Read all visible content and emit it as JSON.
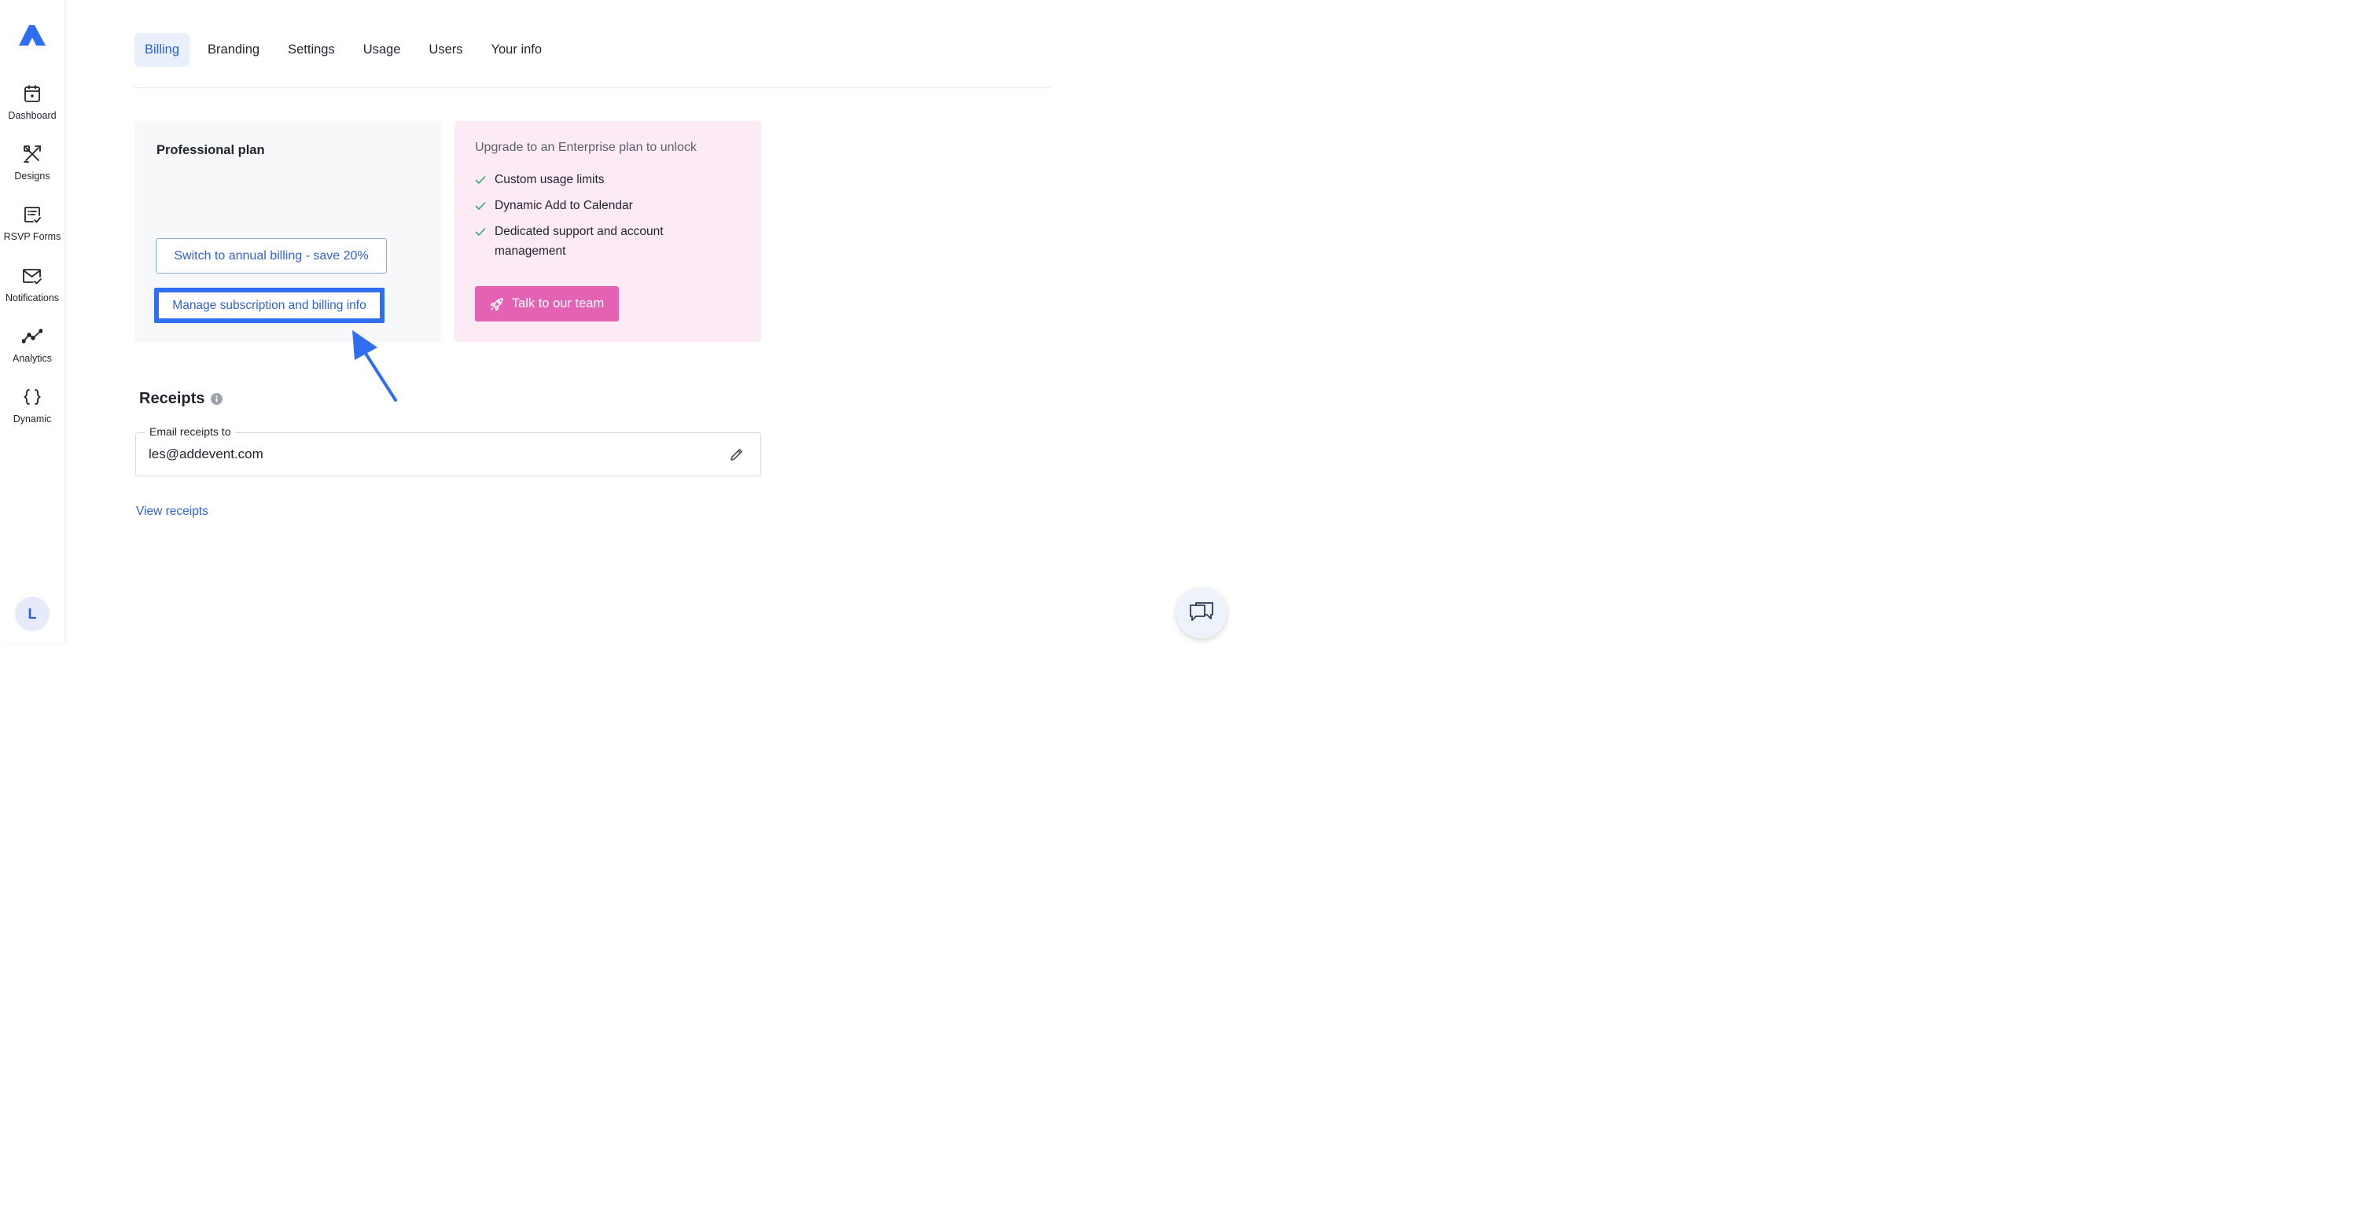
{
  "sidebar": {
    "logo_icon": "addevent-logo-icon",
    "items": [
      {
        "label": "Dashboard",
        "icon": "calendar-icon"
      },
      {
        "label": "Designs",
        "icon": "design-tools-icon"
      },
      {
        "label": "RSVP Forms",
        "icon": "rsvp-form-icon"
      },
      {
        "label": "Notifications",
        "icon": "envelope-check-icon"
      },
      {
        "label": "Analytics",
        "icon": "line-chart-icon"
      },
      {
        "label": "Dynamic",
        "icon": "curly-braces-icon"
      }
    ],
    "avatar_initial": "L"
  },
  "tabs": [
    {
      "label": "Billing",
      "active": true
    },
    {
      "label": "Branding",
      "active": false
    },
    {
      "label": "Settings",
      "active": false
    },
    {
      "label": "Usage",
      "active": false
    },
    {
      "label": "Users",
      "active": false
    },
    {
      "label": "Your info",
      "active": false
    }
  ],
  "plan": {
    "title": "Professional plan",
    "annual_button": "Switch to annual billing - save 20%",
    "manage_button": "Manage subscription and billing info"
  },
  "enterprise": {
    "heading": "Upgrade to an Enterprise plan to unlock",
    "features": [
      "Custom usage limits",
      "Dynamic Add to Calendar",
      "Dedicated support and account management"
    ],
    "cta": "Talk to our team"
  },
  "receipts": {
    "title": "Receipts",
    "email_label": "Email receipts to",
    "email_value": "les@addevent.com",
    "view_link": "View receipts"
  },
  "colors": {
    "accent": "#2f62d3",
    "highlight": "#2f6ef0",
    "enterprise_bg": "#fcebf5",
    "cta_pink": "#e462b4",
    "check_green": "#3aa66a"
  }
}
